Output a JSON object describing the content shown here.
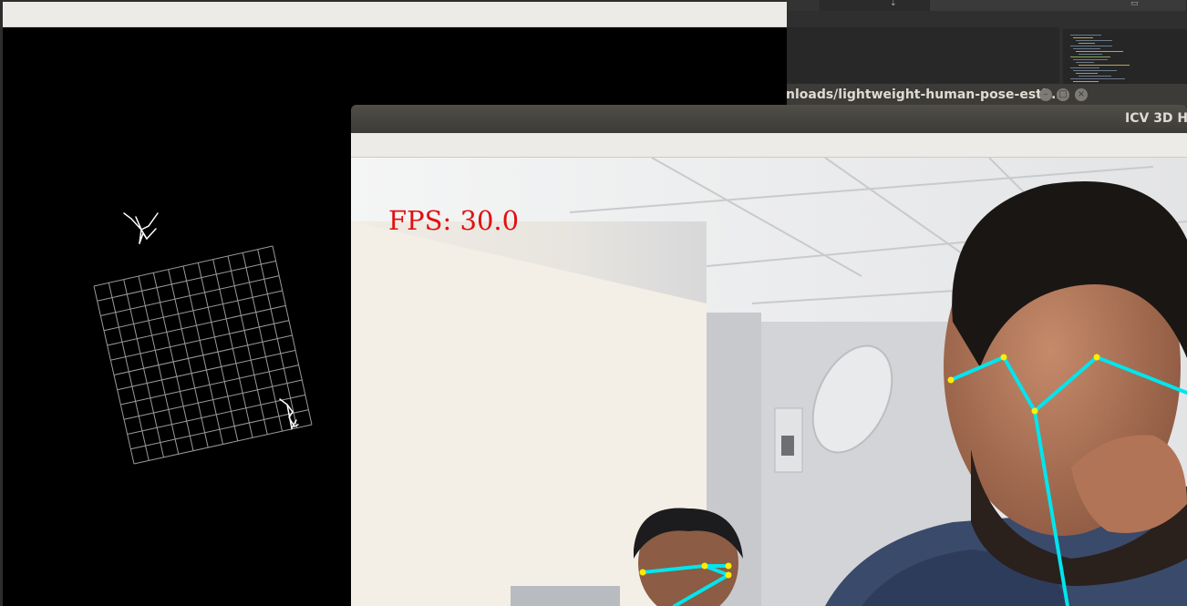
{
  "background_editor": {
    "tab_icons": [
      "download-icon",
      "share-icon"
    ]
  },
  "terminal_window": {
    "title": "nloads/lightweight-human-pose-esti...",
    "buttons": [
      "minimize",
      "maximize",
      "close"
    ]
  },
  "canvas_window": {
    "description_icons": [
      "skeleton-figure-icon"
    ]
  },
  "camera_window": {
    "title": "ICV 3D Hu",
    "fps_text": "FPS: 30.0"
  },
  "colors": {
    "skeleton": "#00e5ee",
    "keypoint": "#ffee00",
    "fps_text": "#e01010",
    "grid": "#9a9a9a"
  }
}
